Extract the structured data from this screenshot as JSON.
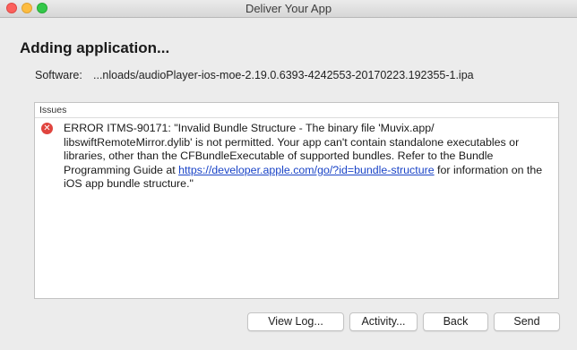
{
  "window": {
    "title": "Deliver Your App"
  },
  "heading": "Adding application...",
  "software": {
    "label": "Software:",
    "value": "...nloads/audioPlayer-ios-moe-2.19.0.6393-4242553-20170223.192355-1.ipa"
  },
  "issues": {
    "header": "Issues",
    "items": [
      {
        "icon": "error-icon",
        "text_before": "ERROR ITMS-90171: \"Invalid Bundle Structure - The binary file 'Muvix.app/ libswiftRemoteMirror.dylib' is not permitted. Your app can't contain standalone executables or libraries, other than the CFBundleExecutable of supported bundles. Refer to the Bundle Programming Guide at ",
        "link": "https://developer.apple.com/go/?id=bundle-structure",
        "text_after": " for information on the iOS app bundle structure.\""
      }
    ]
  },
  "buttons": {
    "view_log": "View Log...",
    "activity": "Activity...",
    "back": "Back",
    "send": "Send"
  },
  "colors": {
    "error": "#e0443e",
    "link": "#1a44c7",
    "close": "#fc605c",
    "minimize": "#fdbc40",
    "maximize": "#34c84a"
  }
}
